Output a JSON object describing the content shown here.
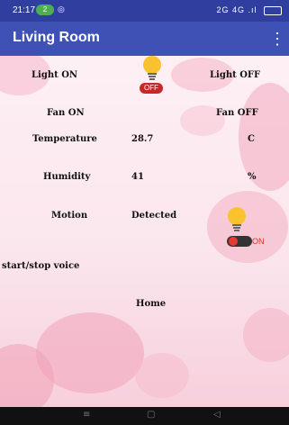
{
  "status_bar": {
    "time": "21:17",
    "pill": "2",
    "right": "2G 4G .ıl"
  },
  "app_bar": {
    "title": "Living Room",
    "menu_icon": "⋮"
  },
  "controls": {
    "light_on": "Light ON",
    "light_off": "Light OFF",
    "light_state": "OFF",
    "fan_on": "Fan ON",
    "fan_off": "Fan OFF",
    "temperature_label": "Temperature",
    "temperature_value": "28.7",
    "temperature_unit": "C",
    "humidity_label": "Humidity",
    "humidity_value": "41",
    "humidity_unit": "%",
    "motion_label": "Motion",
    "motion_value": "Detected",
    "motion_state": "ON",
    "voice_label": "start/stop voice",
    "home_label": "Home"
  },
  "nav_bar": {
    "menu": "≡",
    "home": "▢",
    "back": "◁"
  }
}
